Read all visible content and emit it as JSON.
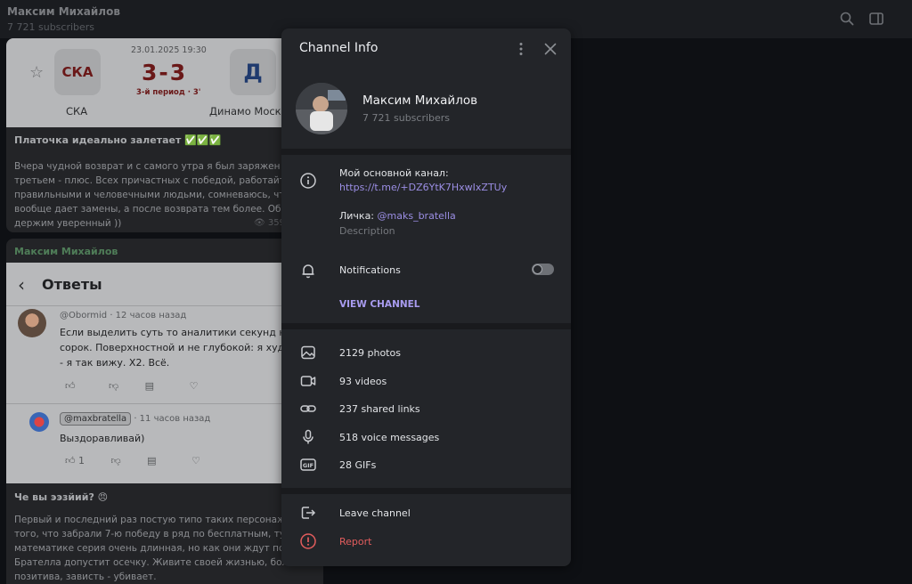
{
  "header": {
    "channel_name": "Максим Михайлов",
    "subscribers": "7 721 subscribers",
    "icons": [
      "search-icon",
      "sidebar-toggle-icon"
    ]
  },
  "messages": [
    {
      "score_card": {
        "date": "23.01.2025 19:30",
        "score": "3-3",
        "period": "3-й период · 3'",
        "home_logo": "СКА",
        "home_name": "СКА",
        "away_logo": "Д",
        "away_name": "Динамо Моск"
      },
      "headline": "Платочка идеально залетает ✅✅✅",
      "text": "Вчера чудной возврат и с самого утра я был заряжен на п\nтретьем - плюс. Всех причастных с победой, работайте с\nправильными и человечными людьми, сомневаюсь, что\nвообще дает замены, а после возврата тем более. Обнял,\nдержим уверенный ))",
      "views": "359"
    },
    {
      "author": "Максим Михайлов",
      "screenshot": {
        "back": "‹",
        "title": "Ответы",
        "comment1_user": "@Obormid",
        "comment1_time": "· 12 часов назад",
        "comment1_text": "Если выделить суть то аналитики секунд на\nсорок. Поверхностной и не глубокой: я худо\n- я так вижу. Х2. Всё.",
        "comment2_user": "@maxbratella",
        "comment2_time": "· 11 часов назад",
        "comment2_text": "Выздоравливай)",
        "comment2_likes": "1"
      },
      "headline": "Че вы ээзйий? 😠",
      "text": "Первый и последний раз постую типо таких персонажей.\nтого, что забрали 7-ю победу в ряд по бесплатным, тут да\nматематике серия очень длинная, но как они ждут пока\nБрателла допустит осечку. Живите своей жизнью, больше\nпозитива, зависть - убивает."
    }
  ],
  "panel": {
    "title": "Channel Info",
    "name": "Максим Михайлов",
    "subscribers": "7 721 subscribers",
    "info_line1": "Мой основной канал:",
    "info_link": "https://t.me/+DZ6YtK7HxwIxZTUy",
    "info_line2_prefix": "Личка: ",
    "info_line2_handle": "@maks_bratella",
    "info_caption": "Description",
    "notifications_label": "Notifications",
    "notifications_on": false,
    "view_channel": "VIEW CHANNEL",
    "media": {
      "photos": "2129 photos",
      "videos": "93 videos",
      "links": "237 shared links",
      "voice": "518 voice messages",
      "gifs": "28 GIFs"
    },
    "leave": "Leave channel",
    "report": "Report",
    "colors": {
      "accent": "#a99cf0",
      "danger": "#e35d5d",
      "panel_bg": "#232529"
    }
  }
}
